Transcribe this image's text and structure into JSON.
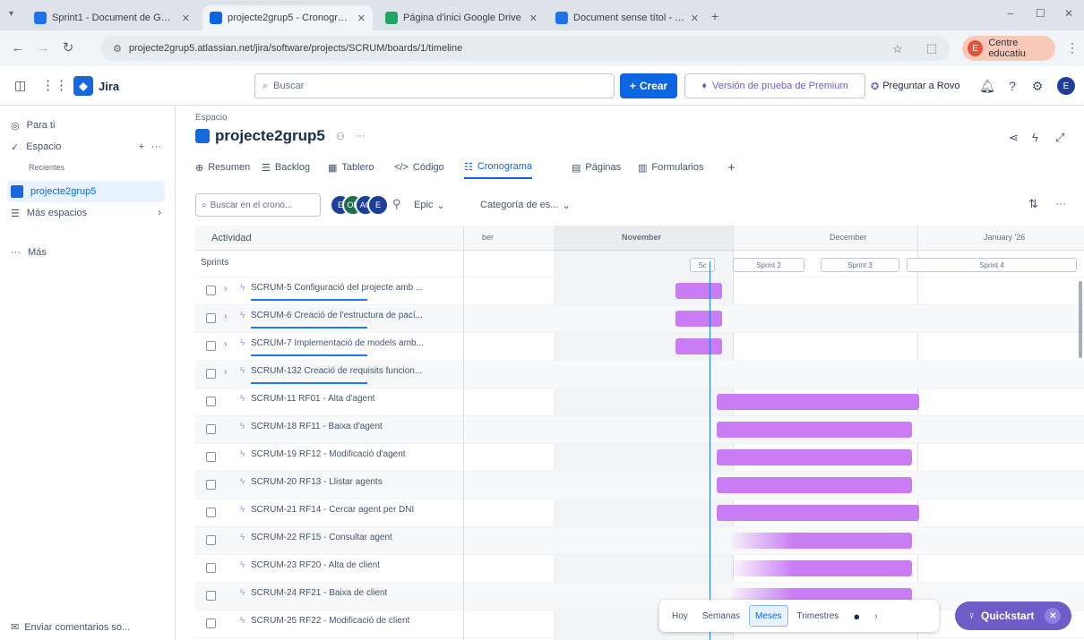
{
  "browser": {
    "tabs": [
      {
        "title": "Sprint1 - Document de Goog...",
        "color": "#1a73e8",
        "active": false
      },
      {
        "title": "projecte2grup5 - Cronograma",
        "color": "#0c66e4",
        "active": true
      },
      {
        "title": "Página d'inici Google Drive",
        "color": "#1fa463",
        "active": false
      },
      {
        "title": "Document sense títol - Docum...",
        "color": "#1a73e8",
        "active": false
      }
    ],
    "url": "projecte2grup5.atlassian.net/jira/software/projects/SCRUM/boards/1/timeline",
    "profile_label": "Centre educatiu"
  },
  "header": {
    "app_name": "Jira",
    "search_placeholder": "Buscar",
    "create_label": "Crear",
    "premium_label": "Versión de prueba de Premium",
    "rovo_label": "Preguntar a Rovo",
    "user_initial": "E"
  },
  "sidebar": {
    "items": [
      {
        "label": "Para ti",
        "icon": "○"
      },
      {
        "label": "Espacio",
        "icon": "✓"
      }
    ],
    "recent_label": "Recientes",
    "project_label": "projecte2grup5",
    "more_spaces_label": "Más espacios",
    "more_label": "Más",
    "feedback_label": "Enviar comentarios so..."
  },
  "project": {
    "breadcrumb": "Espacio",
    "name": "projecte2grup5",
    "tabs": [
      {
        "label": "Resumen",
        "icon": "⊕"
      },
      {
        "label": "Backlog",
        "icon": "☰"
      },
      {
        "label": "Tablero",
        "icon": "▦"
      },
      {
        "label": "Código",
        "icon": "</>"
      },
      {
        "label": "Cronograma",
        "icon": "☷"
      },
      {
        "label": "Páginas",
        "icon": "▤"
      },
      {
        "label": "Formularios",
        "icon": "▥"
      }
    ]
  },
  "toolbar": {
    "search_placeholder": "Buscar en el crono...",
    "epic_label": "Epic",
    "category_label": "Categoría de es..."
  },
  "timeline": {
    "activity_header": "Actividad",
    "sprints_label": "Sprints",
    "months": [
      "ber",
      "November",
      "December",
      "January '26"
    ],
    "sprint_boxes": [
      "Sc",
      "Sprint 2",
      "Sprint 3",
      "Sprint 4"
    ],
    "rows": [
      {
        "label": "SCRUM-5 Configuració del projecte amb ...",
        "epic": true
      },
      {
        "label": "SCRUM-6 Creació de l'estructura de pací...",
        "epic": true
      },
      {
        "label": "SCRUM-7 Implementació de models amb...",
        "epic": true
      },
      {
        "label": "SCRUM-132 Creació de requisits funcion...",
        "epic": true
      },
      {
        "label": "SCRUM-11 RF01 - Alta d'agent",
        "epic": false
      },
      {
        "label": "SCRUM-18 RF11 - Baixa d'agent",
        "epic": false
      },
      {
        "label": "SCRUM-19 RF12 - Modificació d'agent",
        "epic": false
      },
      {
        "label": "SCRUM-20 RF13 - Llistar agents",
        "epic": false
      },
      {
        "label": "SCRUM-21 RF14 - Cercar agent per DNI",
        "epic": false
      },
      {
        "label": "SCRUM-22 RF15 - Consultar agent",
        "epic": false
      },
      {
        "label": "SCRUM-23 RF20 - Alta de client",
        "epic": false
      },
      {
        "label": "SCRUM-24 RF21 - Baixa de client",
        "epic": false
      },
      {
        "label": "SCRUM-25 RF22 - Modificació de client",
        "epic": false
      }
    ]
  },
  "zoom": {
    "options": [
      "Hoy",
      "Semanas",
      "Meses",
      "Trimestres"
    ],
    "selected": "Meses"
  },
  "quickstart_label": "Quickstart",
  "colors": {
    "accent": "#0c66e4",
    "bar": "#c97cf4",
    "quickstart": "#6e5dc6"
  }
}
